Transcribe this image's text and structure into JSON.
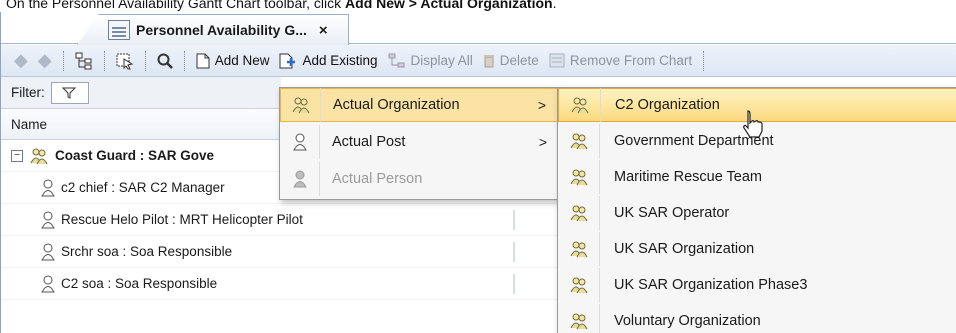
{
  "caption": {
    "prefix": "On the Personnel Availability Gantt Chart toolbar, click ",
    "emphasis": "Add New > Actual Organization",
    "suffix": "."
  },
  "tab": {
    "title": "Personnel Availability G...",
    "close": "×"
  },
  "toolbar": {
    "add_new": "Add New",
    "add_existing": "Add Existing",
    "display_all": "Display All",
    "delete": "Delete",
    "remove_from_chart": "Remove From Chart"
  },
  "filter": {
    "label": "Filter:"
  },
  "table": {
    "column_name": "Name"
  },
  "tree": [
    {
      "label": "Coast Guard : SAR Gove",
      "kind": "organization",
      "expanded": true
    },
    {
      "label": "c2 chief : SAR C2 Manager",
      "kind": "person"
    },
    {
      "label": "Rescue Helo Pilot : MRT Helicopter Pilot",
      "kind": "person"
    },
    {
      "label": "Srchr soa : Soa Responsible",
      "kind": "person"
    },
    {
      "label": "C2 soa : Soa Responsible",
      "kind": "person"
    }
  ],
  "menu": {
    "items": [
      {
        "label": "Actual Organization",
        "has_submenu": true,
        "selected": true,
        "enabled": true
      },
      {
        "label": "Actual Post",
        "has_submenu": true,
        "selected": false,
        "enabled": true
      },
      {
        "label": "Actual Person",
        "has_submenu": false,
        "selected": false,
        "enabled": false
      }
    ],
    "submenu": [
      {
        "label": "C2 Organization",
        "selected": true
      },
      {
        "label": "Government Department",
        "selected": false
      },
      {
        "label": "Maritime Rescue Team",
        "selected": false
      },
      {
        "label": "UK SAR Operator",
        "selected": false
      },
      {
        "label": "UK SAR Organization",
        "selected": false
      },
      {
        "label": "UK SAR Organization Phase3",
        "selected": false
      },
      {
        "label": "Voluntary Organization",
        "selected": false
      }
    ]
  },
  "colors": {
    "menu_highlight": "#fbe3a6",
    "menu_highlight_border": "#e6b64a",
    "accent": "#2d6cc0"
  },
  "icons": [
    "back-arrow-icon",
    "forward-arrow-icon",
    "tree-icon",
    "select-icon",
    "search-icon",
    "new-document-icon",
    "add-existing-icon",
    "display-all-icon",
    "delete-icon",
    "remove-from-chart-icon",
    "filter-icon",
    "organization-icon",
    "person-icon",
    "chevron-right-icon",
    "cursor-icon"
  ]
}
